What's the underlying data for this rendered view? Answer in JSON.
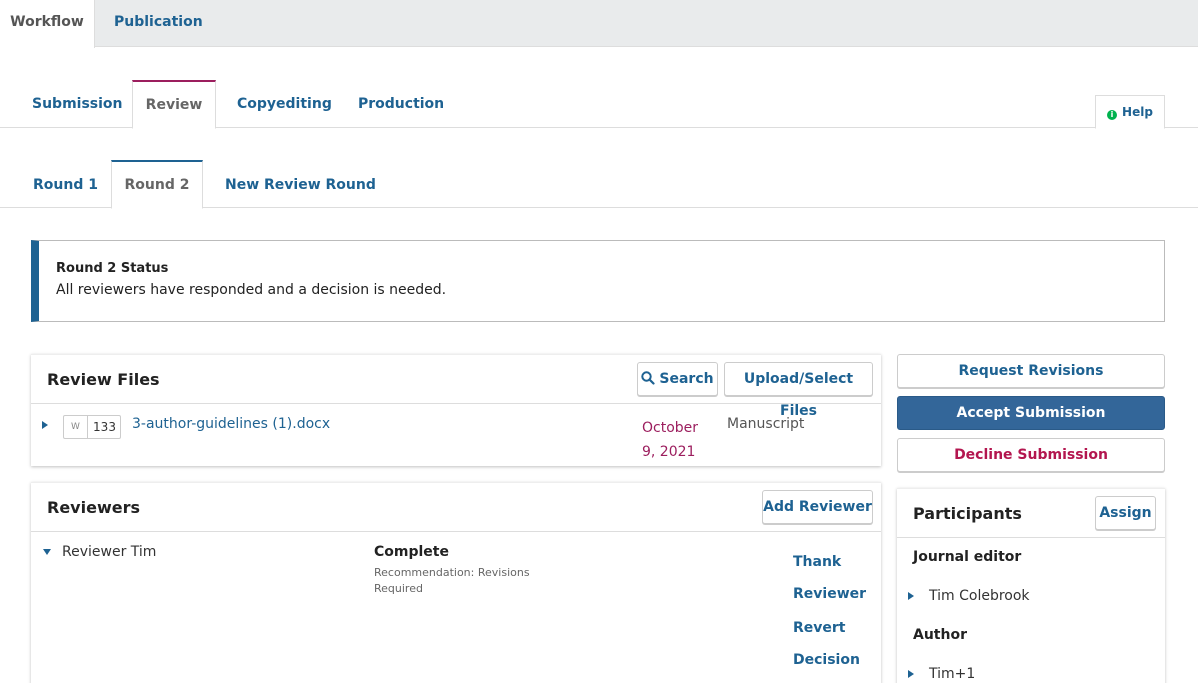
{
  "top_tabs": {
    "workflow": "Workflow",
    "publication": "Publication"
  },
  "stage_tabs": {
    "submission": "Submission",
    "review": "Review",
    "copyediting": "Copyediting",
    "production": "Production"
  },
  "help": {
    "label": "Help",
    "icon": "info-icon"
  },
  "round_tabs": {
    "round1": "Round 1",
    "round2": "Round 2",
    "new_round": "New Review Round"
  },
  "status": {
    "title": "Round 2 Status",
    "text": "All reviewers have responded and a decision is needed."
  },
  "review_files": {
    "title": "Review Files",
    "search_label": "Search",
    "upload_label": "Upload/Select Files",
    "files": [
      {
        "id": "133",
        "name": "3-author-guidelines (1).docx",
        "date_line1": "October",
        "date_line2": "9, 2021",
        "type": "Manuscript",
        "icon": "word-doc-icon"
      }
    ]
  },
  "reviewers": {
    "title": "Reviewers",
    "add_label": "Add Reviewer",
    "rows": [
      {
        "name": "Reviewer Tim",
        "status": "Complete",
        "rec_line1": "Recommendation: Revisions",
        "rec_line2": "Required",
        "action1_line1": "Thank",
        "action1_line2": "Reviewer",
        "action2_line1": "Revert",
        "action2_line2": "Decision"
      }
    ]
  },
  "decisions": {
    "request_revisions": "Request Revisions",
    "accept": "Accept Submission",
    "decline": "Decline Submission"
  },
  "participants": {
    "title": "Participants",
    "assign_label": "Assign",
    "groups": [
      {
        "role": "Journal editor",
        "member": "Tim Colebrook"
      },
      {
        "role": "Author",
        "member": "Tim+1"
      }
    ]
  },
  "colors": {
    "primary": "#1e6292",
    "accent": "#9c1e5e",
    "date": "#9c1e5e",
    "accept_bg": "#336699"
  }
}
